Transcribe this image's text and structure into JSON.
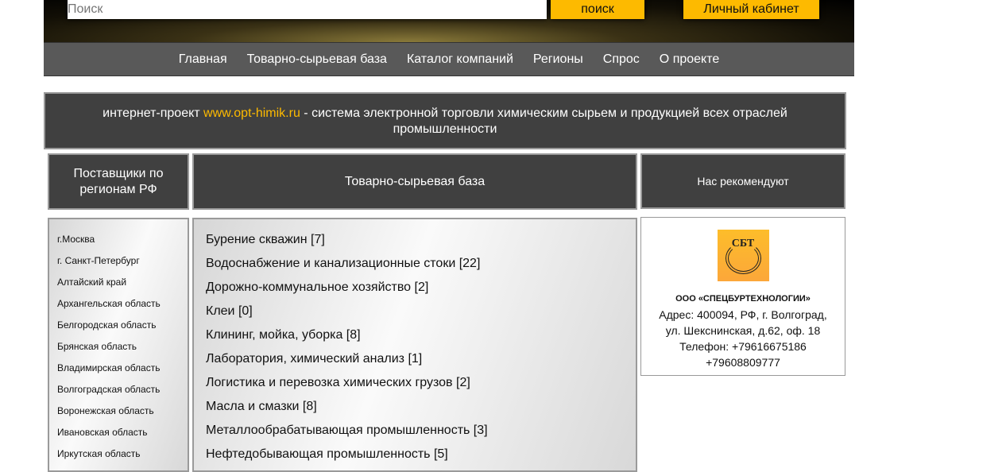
{
  "header": {
    "search_placeholder": "Поиск",
    "search_button": "поиск",
    "cabinet_button": "Личный кабинет"
  },
  "nav": [
    "Главная",
    "Товарно-сырьевая база",
    "Каталог компаний",
    "Регионы",
    "Спрос",
    "О проекте"
  ],
  "intro": {
    "prefix": "интернет-проект ",
    "link": "www.opt-himik.ru",
    "suffix": " - система электронной торговли химическим сырьем и продукцией всех отраслей промышленности"
  },
  "columns": {
    "regions_title": "Поставщики по регионам РФ",
    "catalog_title": "Товарно-сырьевая база",
    "recommend_title": "Нас рекомендуют"
  },
  "regions": [
    "г.Москва",
    "г. Санкт-Петербург",
    "Алтайский край",
    "Архангельская область",
    "Белгородская область",
    "Брянская область",
    "Владимирская область",
    "Волгоградская область",
    "Воронежская область",
    "Ивановская область",
    "Иркутская область"
  ],
  "categories": [
    "Бурение скважин [7]",
    "Водоснабжение и канализационные стоки [22]",
    "Дорожно-коммунальное хозяйство [2]",
    "Клеи [0]",
    "Клининг, мойка, уборка [8]",
    "Лаборатория, химический анализ [1]",
    "Логистика и перевозка химических грузов [2]",
    "Масла и смазки [8]",
    "Металлообрабатывающая промышленность [3]",
    "Нефтедобывающая промышленность [5]"
  ],
  "recommend": {
    "logo_text": "СБТ",
    "company": "ООО «СПЕЦБУРТЕХНОЛОГИИ»",
    "address1": "Адрес: 400094, РФ, г. Волгоград,",
    "address2": "ул. Шекснинская, д.62, оф. 18",
    "phone1": "Телефон: +79616675186",
    "phone2": "+79608809777"
  }
}
